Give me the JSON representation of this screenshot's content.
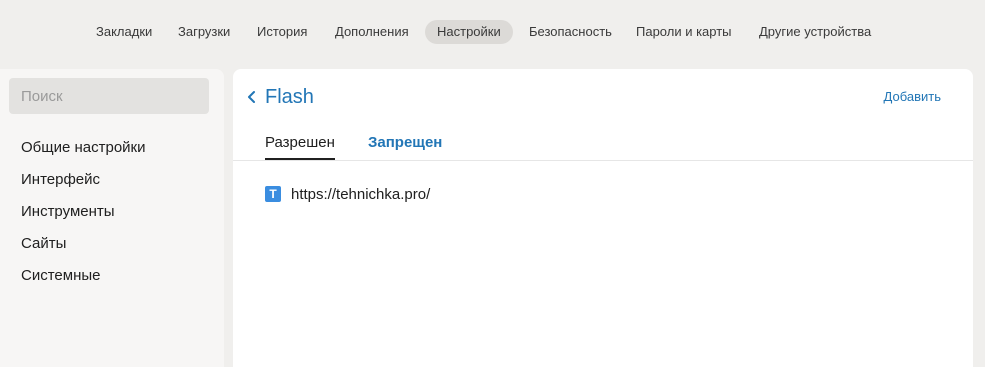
{
  "top_nav": {
    "items": [
      {
        "label": "Закладки",
        "active": false
      },
      {
        "label": "Загрузки",
        "active": false
      },
      {
        "label": "История",
        "active": false
      },
      {
        "label": "Дополнения",
        "active": false
      },
      {
        "label": "Настройки",
        "active": true
      },
      {
        "label": "Безопасность",
        "active": false
      },
      {
        "label": "Пароли и карты",
        "active": false
      },
      {
        "label": "Другие устройства",
        "active": false
      }
    ]
  },
  "sidebar": {
    "search_placeholder": "Поиск",
    "items": [
      {
        "label": "Общие настройки"
      },
      {
        "label": "Интерфейс"
      },
      {
        "label": "Инструменты"
      },
      {
        "label": "Сайты"
      },
      {
        "label": "Системные"
      }
    ]
  },
  "main": {
    "back_icon": "chevron-left-icon",
    "title": "Flash",
    "add_label": "Добавить",
    "tabs": [
      {
        "label": "Разрешен",
        "active": true
      },
      {
        "label": "Запрещен",
        "active": false
      }
    ],
    "sites": [
      {
        "favicon_letter": "T",
        "url": "https://tehnichka.pro/"
      }
    ]
  },
  "colors": {
    "accent": "#2276b6",
    "background": "#f0efed",
    "favicon": "#3a8de0"
  }
}
